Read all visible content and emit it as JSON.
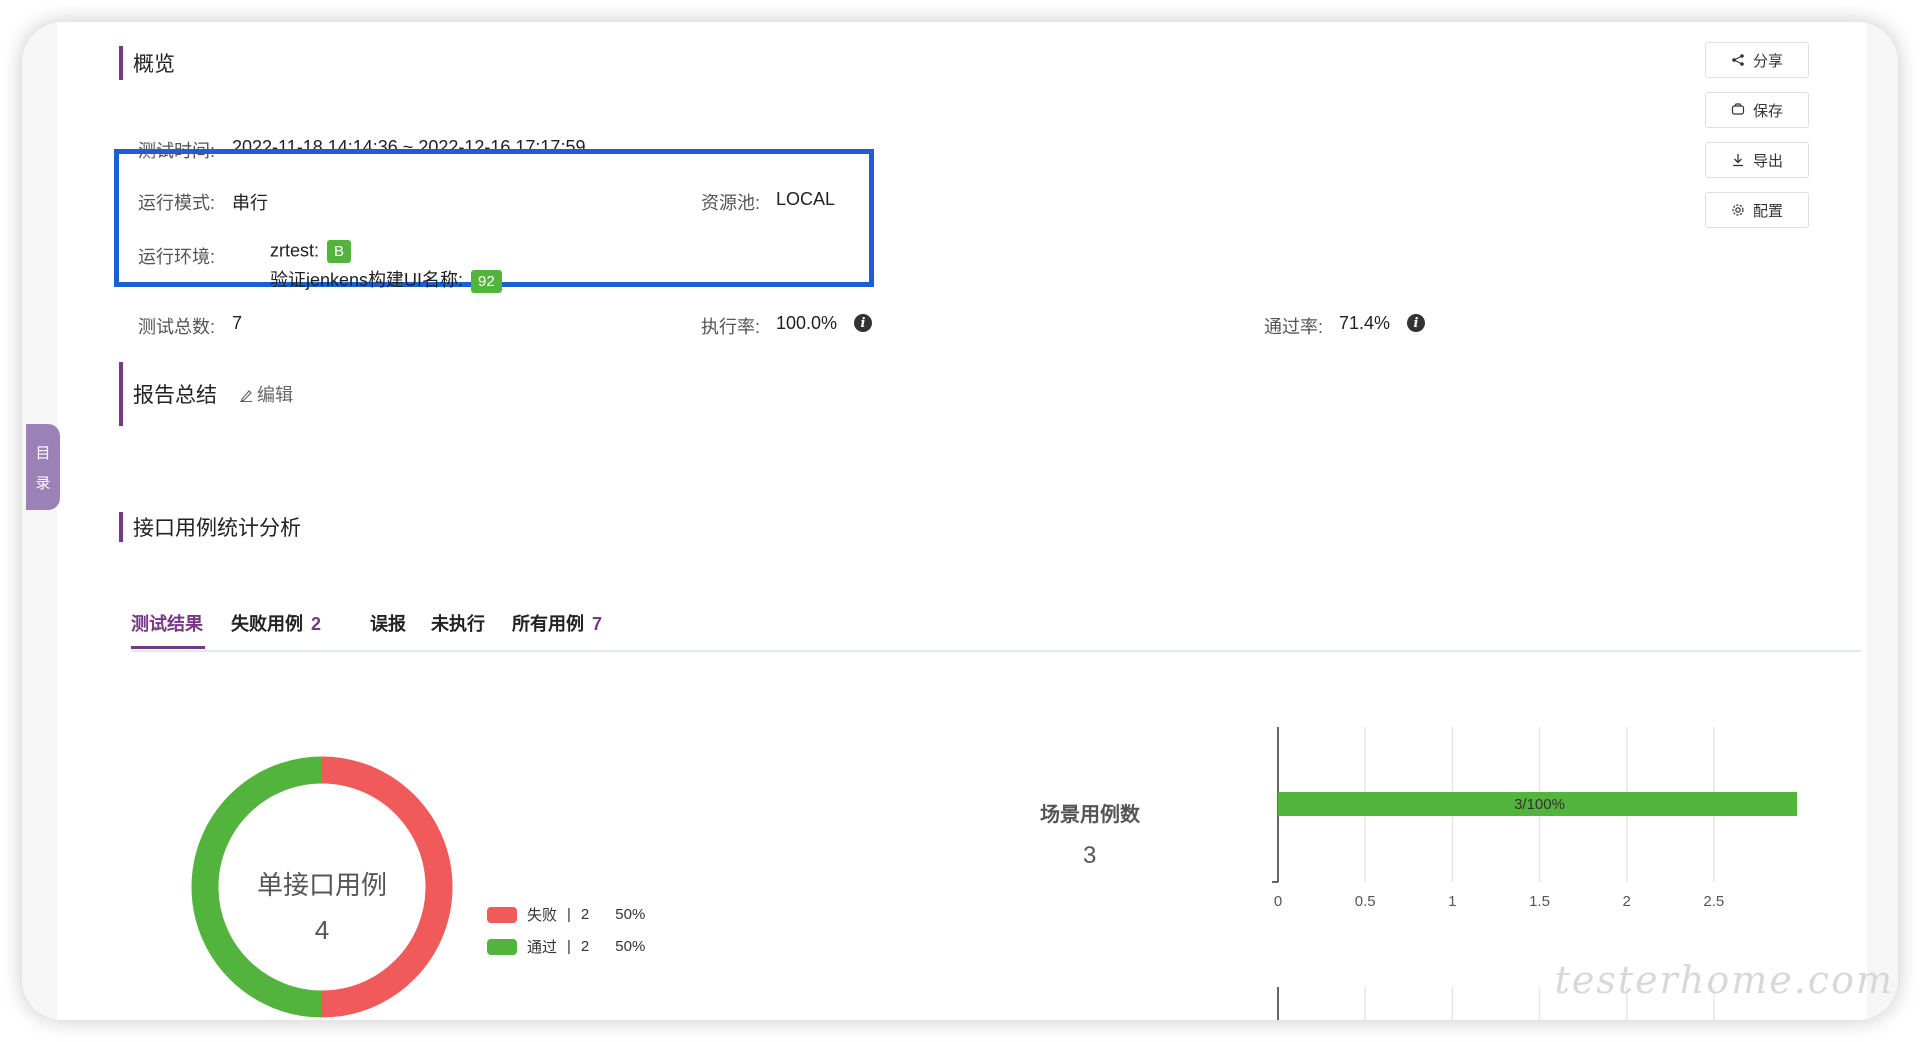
{
  "toc": {
    "label_line1": "目",
    "label_line2": "录"
  },
  "overview": {
    "title": "概览",
    "test_time_label": "测试时间:",
    "test_time_value": "2022-11-18 14:14:36 ~ 2022-12-16 17:17:59",
    "run_mode_label": "运行模式:",
    "run_mode_value": "串行",
    "resource_pool_label": "资源池:",
    "resource_pool_value": "LOCAL",
    "env_label": "运行环境:",
    "env_items": [
      {
        "name": "zrtest:",
        "tag": "B"
      },
      {
        "name": "验证jenkens构建UI名称:",
        "tag": "92"
      }
    ],
    "total_label": "测试总数:",
    "total_value": "7",
    "exec_rate_label": "执行率:",
    "exec_rate_value": "100.0%",
    "pass_rate_label": "通过率:",
    "pass_rate_value": "71.4%"
  },
  "actions": {
    "share": "分享",
    "save": "保存",
    "export": "导出",
    "config": "配置"
  },
  "summary": {
    "title": "报告总结",
    "edit_label": "编辑"
  },
  "analysis": {
    "title": "接口用例统计分析",
    "tabs": [
      {
        "label": "测试结果",
        "count": ""
      },
      {
        "label": "失败用例",
        "count": "2"
      },
      {
        "label": "误报",
        "count": ""
      },
      {
        "label": "未执行",
        "count": ""
      },
      {
        "label": "所有用例",
        "count": "7"
      }
    ]
  },
  "chart_data": [
    {
      "type": "pie",
      "title": "单接口用例",
      "total": "4",
      "slices": [
        {
          "name": "失败",
          "count": "2",
          "percent": "50%",
          "value": 2,
          "color": "#f05a5a"
        },
        {
          "name": "通过",
          "count": "2",
          "percent": "50%",
          "value": 2,
          "color": "#52b43c"
        }
      ]
    },
    {
      "type": "bar",
      "orientation": "horizontal",
      "category_label": "场景用例数",
      "category_value": "3",
      "values": [
        3
      ],
      "bar_label": "3/100%",
      "color": "#52b43c",
      "xlim": [
        0,
        3
      ],
      "ticks": [
        "0",
        "0.5",
        "1",
        "1.5",
        "2",
        "2.5",
        "3"
      ],
      "grid": true
    }
  ],
  "watermark": "testerhome.com"
}
